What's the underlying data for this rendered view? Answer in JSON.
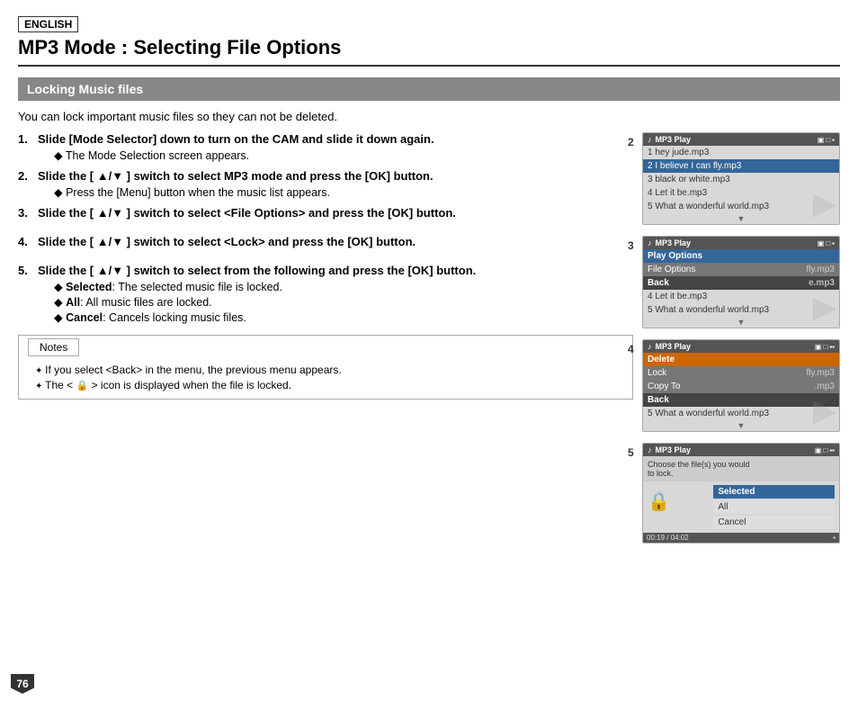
{
  "page": {
    "lang_tag": "ENGLISH",
    "title": "MP3 Mode : Selecting File Options",
    "section_header": "Locking Music files",
    "intro": "You can lock important music files so they can not be deleted.",
    "page_number": "76"
  },
  "steps": [
    {
      "number": "1.",
      "title": "Slide [Mode Selector] down to turn on the CAM and slide it down again.",
      "bullets": [
        "The Mode Selection screen appears."
      ]
    },
    {
      "number": "2.",
      "title": "Slide the [ ▲/▼ ] switch to select MP3 mode and press the [OK] button.",
      "bullets": [
        "Press the [Menu] button when the music list appears."
      ]
    },
    {
      "number": "3.",
      "title": "Slide the [ ▲/▼ ] switch to select <File Options> and press the [OK] button.",
      "bullets": []
    },
    {
      "number": "4.",
      "title": "Slide the [ ▲/▼ ] switch to select <Lock> and press the [OK] button.",
      "bullets": []
    },
    {
      "number": "5.",
      "title": "Slide the [ ▲/▼ ] switch to select from the following and press the [OK] button.",
      "bullets": [
        "Selected: The selected music file is locked.",
        "All: All music files are locked.",
        "Cancel: Cancels locking music files."
      ]
    }
  ],
  "notes": {
    "header": "Notes",
    "items": [
      "If you select <Back> in the menu, the previous menu appears.",
      "The <  > icon is displayed when the file is locked."
    ]
  },
  "panels": [
    {
      "num": "2",
      "header_title": "MP3 Play",
      "items": [
        {
          "text": "1  hey jude.mp3",
          "style": "normal"
        },
        {
          "text": "2  I believe I can fly.mp3",
          "style": "highlighted"
        },
        {
          "text": "3  black or white.mp3",
          "style": "normal"
        },
        {
          "text": "4  Let it be.mp3",
          "style": "normal"
        },
        {
          "text": "5  What a wonderful world.mp3",
          "style": "normal"
        }
      ],
      "show_arrow": true
    },
    {
      "num": "3",
      "header_title": "MP3 Play",
      "items": [
        {
          "text": "Play Options",
          "style": "menu-blue"
        },
        {
          "text": "File Options         fly.mp3",
          "style": "menu-gray"
        },
        {
          "text": "Back                 e.mp3",
          "style": "menu-dark"
        },
        {
          "text": "4  Let it be.mp3",
          "style": "normal"
        },
        {
          "text": "5  What a wonderful world.mp3",
          "style": "normal"
        }
      ],
      "show_arrow": true
    },
    {
      "num": "4",
      "header_title": "MP3 Play",
      "items": [
        {
          "text": "Delete",
          "style": "menu-orange"
        },
        {
          "text": "Lock                 fly.mp3",
          "style": "menu-gray"
        },
        {
          "text": "Copy To              .mp3",
          "style": "menu-gray"
        },
        {
          "text": "Back",
          "style": "menu-dark"
        },
        {
          "text": "5  What a wonderful world.mp3",
          "style": "normal"
        }
      ],
      "show_arrow": true
    },
    {
      "num": "5",
      "header_title": "MP3 Play",
      "choose_text": "Choose the file(s) you would to lock.",
      "lock_items": [
        {
          "text": "Selected",
          "style": "menu-selected-blue"
        },
        {
          "text": "All",
          "style": "menu-all"
        },
        {
          "text": "Cancel",
          "style": "menu-cancel"
        }
      ],
      "timestamp": "00:19 / 04:02",
      "show_lock": true
    }
  ],
  "icons": {
    "music_note": "♪",
    "lock": "🔒",
    "down_triangle": "▼"
  }
}
